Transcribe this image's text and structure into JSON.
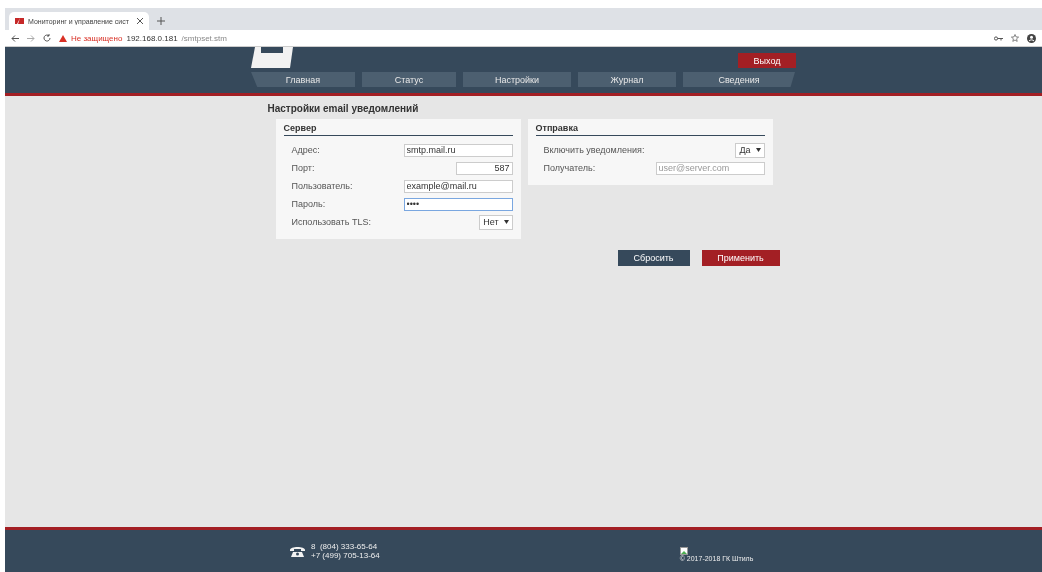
{
  "browser": {
    "tab_title": "Мониторинг и управление сист",
    "url_warning": "Не защищено",
    "url_host": "192.168.0.181",
    "url_path": "/smtpset.stm"
  },
  "header": {
    "logout": "Выход",
    "nav": [
      {
        "label": "Главная",
        "selected": false
      },
      {
        "label": "Статус",
        "selected": false
      },
      {
        "label": "Настройки",
        "selected": false
      },
      {
        "label": "Журнал",
        "selected": false
      },
      {
        "label": "Сведения",
        "selected": false
      }
    ]
  },
  "page_title": "Настройки email уведомлений",
  "panels": [
    {
      "title": "Сервер",
      "fields": [
        {
          "label": "Адрес:",
          "kind": "text",
          "value": "smtp.mail.ru"
        },
        {
          "label": "Порт:",
          "kind": "number",
          "value": "587"
        },
        {
          "label": "Пользователь:",
          "kind": "text",
          "value": "example@mail.ru"
        },
        {
          "label": "Пароль:",
          "kind": "password",
          "value": "••••",
          "focused": true
        },
        {
          "label": "Использовать TLS:",
          "kind": "select",
          "value": "Нет"
        }
      ]
    },
    {
      "title": "Отправка",
      "fields": [
        {
          "label": "Включить уведомления:",
          "kind": "select",
          "value": "Да"
        },
        {
          "label": "Получатель:",
          "kind": "text",
          "placeholder": "user@server.com"
        }
      ]
    }
  ],
  "buttons": [
    {
      "label": "Сбросить",
      "kind": "secondary"
    },
    {
      "label": "Применить",
      "kind": "primary"
    }
  ],
  "footer": {
    "phones": [
      "8  (804) 333-65-64",
      "+7 (499) 705-13-64"
    ],
    "copyright": "© 2017-2018 ГК Штиль"
  }
}
